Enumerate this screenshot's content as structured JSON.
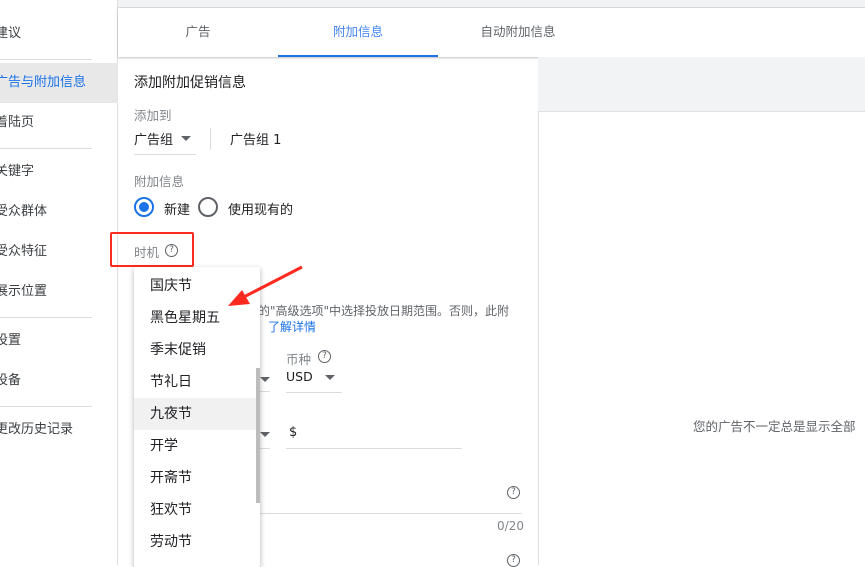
{
  "sidebar": {
    "items": [
      "建议",
      "广告与附加信息",
      "着陆页",
      "关键字",
      "受众群体",
      "受众特征",
      "展示位置",
      "设置",
      "设备",
      "更改历史记录"
    ],
    "selected": "广告与附加信息"
  },
  "tabs": [
    "广告",
    "附加信息",
    "自动附加信息"
  ],
  "active_tab": "附加信息",
  "form": {
    "title": "添加附加促销信息",
    "add_to_label": "添加到",
    "level_select": "广告组",
    "level_value": "广告组 1",
    "extension_label": "附加信息",
    "radio_new": "新建",
    "radio_existing": "使用现有的",
    "occasion_label": "时机",
    "help_glyph": "?",
    "hint_text": "的\"高级选项\"中选择投放日期范围。否则，此附",
    "learn_more": "了解详情",
    "currency_label": "币种",
    "currency_value": "USD",
    "amount_prefix": "$",
    "char_count": "0/20"
  },
  "occasion_menu": {
    "items": [
      "国庆节",
      "黑色星期五",
      "季末促销",
      "节礼日",
      "九夜节",
      "开学",
      "开斋节",
      "狂欢节",
      "劳动节"
    ],
    "hovered": "九夜节"
  },
  "preview": {
    "text": "您的广告不一定总是显示全部"
  },
  "colors": {
    "accent": "#1a73e8",
    "annotation": "#ff2a1f"
  }
}
